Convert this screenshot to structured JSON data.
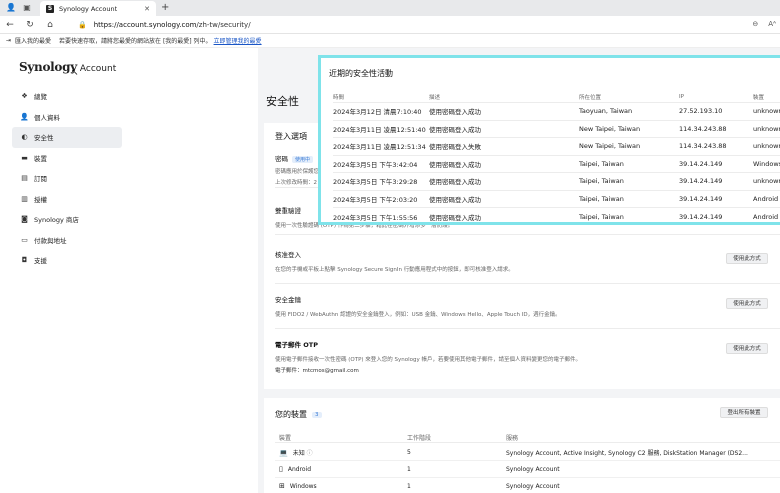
{
  "browser": {
    "tab_title": "Synology Account",
    "tab_close": "✕",
    "new_tab": "+",
    "url_host": "https://account.synology.com",
    "url_path": "/zh-tw/security/",
    "favbar_import": "匯入我的最愛",
    "favbar_message": "若要快速存取，請將您最愛的網站放在 [我的最愛] 列中。",
    "favbar_link": "立即管理我的最愛"
  },
  "brand": {
    "logo": "Synology",
    "suffix": "Account"
  },
  "sidebar": {
    "items": [
      {
        "label": "總覽",
        "icon": "overview-icon"
      },
      {
        "label": "個人資料",
        "icon": "person-icon"
      },
      {
        "label": "安全性",
        "icon": "shield-icon",
        "active": true
      },
      {
        "label": "裝置",
        "icon": "device-icon"
      },
      {
        "label": "訂閱",
        "icon": "subscription-icon"
      },
      {
        "label": "授權",
        "icon": "license-icon"
      },
      {
        "label": "Synology 商店",
        "icon": "store-icon"
      },
      {
        "label": "付款與地址",
        "icon": "payment-icon"
      },
      {
        "label": "支援",
        "icon": "support-icon"
      }
    ]
  },
  "main": {
    "title": "安全性",
    "login": {
      "heading": "登入選項",
      "password_label": "密碼",
      "password_badge": "使用中",
      "password_desc1": "密碼應用於保護您",
      "password_desc2": "上次修改時間：2",
      "twofa_title": "雙重驗證",
      "twofa_desc": "使用一次性驗證碼 (OTP) 作為第二步驟，藉此在密碼外增添多一層防護。",
      "approve_title": "核准登入",
      "approve_desc": "在您的手機或平板上點擊 Synology Secure SignIn 行動應用程式中的按鈕，即可核准登入請求。",
      "key_title": "安全金鑰",
      "key_desc": "使用 FIDO2 / WebAuthn 認證的安全金鑰登入，例如：USB 金鑰、Windows Hello、Apple Touch ID，週行金鑰。",
      "email_title": "電子郵件 OTP",
      "email_desc": "使用電子郵件接收一次性密碼 (OTP) 來登入您的 Synology 帳戶，若要使用其他電子郵件，請至個人資料變更您的電子郵件。",
      "email_addr": "電子郵件：mtcmos@gmail.com",
      "use_button": "使用此方式"
    },
    "devices": {
      "heading": "您的裝置",
      "count": "3",
      "logout_all": "登出所有裝置",
      "col_device": "裝置",
      "col_sessions": "工作階段",
      "col_service": "服務",
      "rows": [
        {
          "device": "未知",
          "sessions": "5",
          "service": "Synology Account, Active Insight, Synology C2 服務, DiskStation Manager (DS2...",
          "icon": "laptop-icon"
        },
        {
          "device": "Android",
          "sessions": "1",
          "service": "Synology Account",
          "icon": "android-icon"
        },
        {
          "device": "Windows",
          "sessions": "1",
          "service": "Synology Account",
          "icon": "windows-icon"
        }
      ]
    }
  },
  "activity": {
    "title": "近期的安全性活動",
    "headers": [
      "時間",
      "描述",
      "所在位置",
      "IP",
      "裝置"
    ],
    "rows": [
      [
        "2024年3月12日 清晨7:10:40",
        "使用密碼登入成功",
        "Taoyuan, Taiwan",
        "27.52.193.10",
        "unknown"
      ],
      [
        "2024年3月11日 凌晨12:51:40",
        "使用密碼登入成功",
        "New Taipei, Taiwan",
        "114.34.243.88",
        "unknown"
      ],
      [
        "2024年3月11日 凌晨12:51:34",
        "使用密碼登入失敗",
        "New Taipei, Taiwan",
        "114.34.243.88",
        "unknown"
      ],
      [
        "2024年3月5日 下午3:42:04",
        "使用密碼登入成功",
        "Taipei, Taiwan",
        "39.14.24.149",
        "Windows"
      ],
      [
        "2024年3月5日 下午3:29:28",
        "使用密碼登入成功",
        "Taipei, Taiwan",
        "39.14.24.149",
        "unknown"
      ],
      [
        "2024年3月5日 下午2:03:20",
        "使用密碼登入成功",
        "Taipei, Taiwan",
        "39.14.24.149",
        "Android /"
      ],
      [
        "2024年3月5日 下午1:55:56",
        "使用密碼登入成功",
        "Taipei, Taiwan",
        "39.14.24.149",
        "Android /"
      ]
    ]
  }
}
